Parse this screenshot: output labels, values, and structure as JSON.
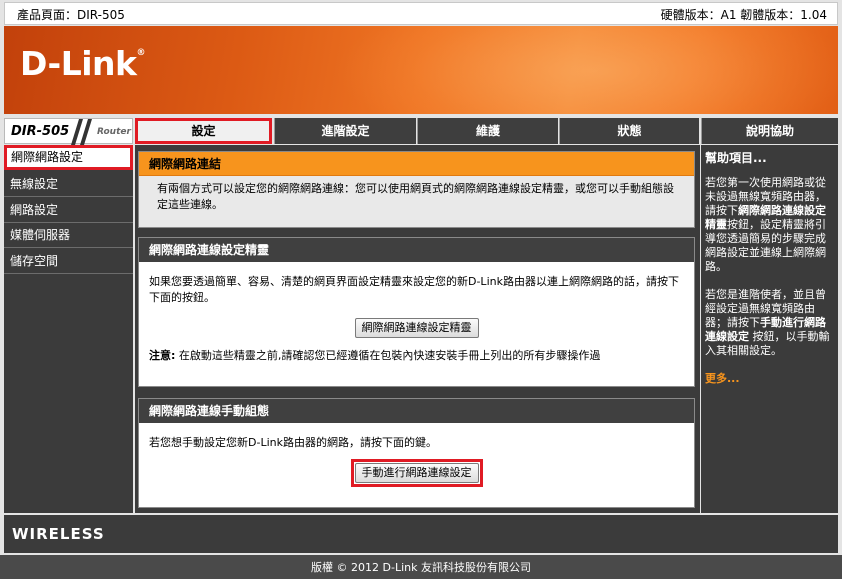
{
  "topbar": {
    "product": "產品頁面：DIR-505",
    "versions": "硬體版本：A1   韌體版本：1.04"
  },
  "brand": {
    "logo": "D-Link",
    "logo_mark": "®",
    "model": "DIR-505",
    "router": "Router"
  },
  "tabs": [
    "設定",
    "進階設定",
    "維護",
    "狀態",
    "說明協助"
  ],
  "sidebar": {
    "items": [
      {
        "label": "網際網路設定"
      },
      {
        "label": "無線設定"
      },
      {
        "label": "網路設定"
      },
      {
        "label": "媒體伺服器"
      },
      {
        "label": "儲存空間"
      }
    ]
  },
  "main": {
    "sec1": {
      "title": "網際網路連結",
      "text": "有兩個方式可以設定您的網際網路連線：您可以使用網頁式的網際網路連線設定精靈，或您可以手動組態設定這些連線。"
    },
    "sec2": {
      "title": "網際網路連線設定精靈",
      "text": "如果您要透過簡單、容易、清楚的網頁界面設定精靈來設定您的新D-Link路由器以連上網際網路的話，請按下下面的按鈕。",
      "button": "網際網路連線設定精靈",
      "note_label": "注意:",
      "note": " 在啟動這些精靈之前,請確認您已經遵循在包裝內快速安裝手冊上列出的所有步驟操作過"
    },
    "sec3": {
      "title": "網際網路連線手動組態",
      "text": "若您想手動設定您新D-Link路由器的網路，請按下面的鍵。",
      "button": "手動進行網路連線設定"
    }
  },
  "help": {
    "title": "幫助項目...",
    "p1_a": "若您第一次使用網路或從未設過無線寬頻路由器，請按下",
    "p1_b": "網際網路連線設定精靈",
    "p1_c": "按鈕，設定精靈將引導您透過簡易的步驟完成網路設定並連線上網際網路。",
    "p2_a": "若您是進階使者，並且曾經設定過無線寬頻路由器；請按下",
    "p2_b": "手動進行網路連線設定",
    "p2_c": " 按鈕，以手動輸入其相關設定。",
    "more": "更多..."
  },
  "footer": {
    "wireless": "WIRELESS",
    "copyright": "版權 © 2012 D-Link 友訊科技股份有限公司"
  },
  "colors": {
    "accent_orange": "#f7941d",
    "highlight_red": "#e01b24",
    "dark": "#3b3b3b"
  }
}
